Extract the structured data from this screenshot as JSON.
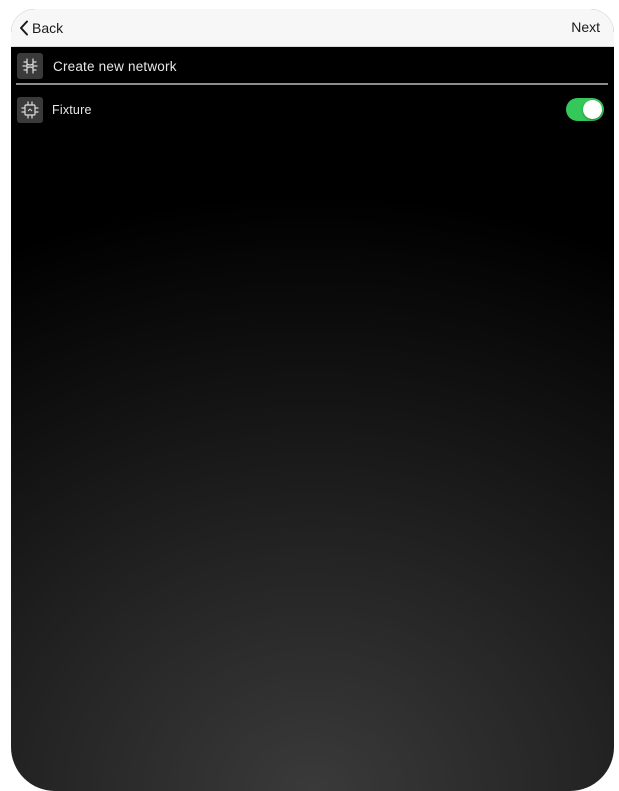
{
  "navbar": {
    "back_label": "Back",
    "next_label": "Next"
  },
  "rows": {
    "create_network": {
      "label": "Create new network",
      "icon": "network-icon"
    },
    "fixture": {
      "label": "Fixture",
      "icon": "chip-icon",
      "toggle_on": true
    }
  },
  "colors": {
    "toggle_on": "#34c759",
    "navbar_bg": "#f7f7f7",
    "row_text": "#e8e8e8"
  }
}
